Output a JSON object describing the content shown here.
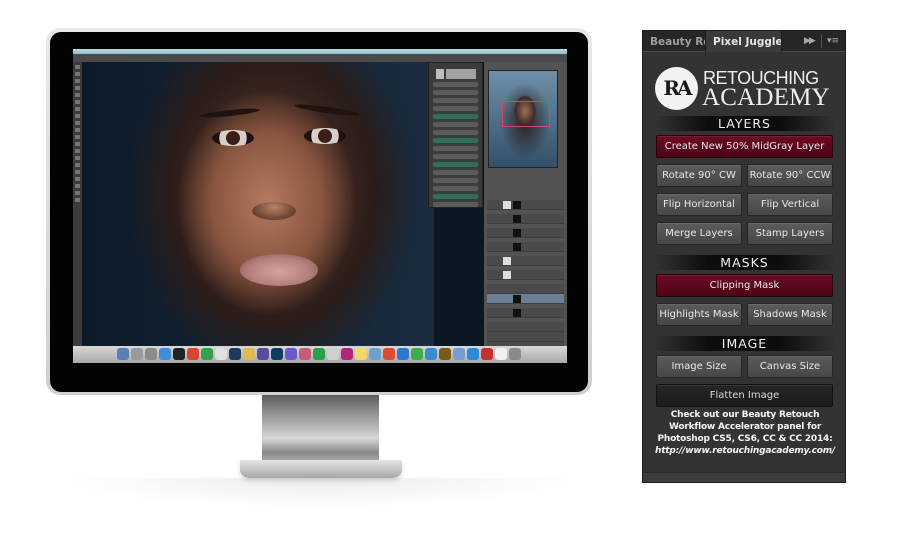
{
  "monitor": {
    "description": "Desktop monitor showing Photoshop with portrait retouching",
    "dock_icon_colors": [
      "#5a7fb5",
      "#9a9a9a",
      "#8c8c8c",
      "#3d8fd6",
      "#222222",
      "#d9452f",
      "#37a04a",
      "#e0e0e0",
      "#1c3a5e",
      "#e2b850",
      "#5a4aa0",
      "#0f3d5e",
      "#6a5acd",
      "#c85a7a",
      "#2aa04a",
      "#d0d0d0",
      "#b5237a",
      "#f0d86a",
      "#6fa0d0",
      "#e04a30",
      "#2a7ad0",
      "#3ab04a",
      "#3a8ad0",
      "#7a5a1a",
      "#7a9ad0",
      "#2a8ad8",
      "#c83030",
      "#f0f0f0",
      "#8a8a8a"
    ]
  },
  "panel": {
    "tabs": [
      {
        "label": "Beauty Ret",
        "active": false
      },
      {
        "label": "Pixel Juggler",
        "active": true
      }
    ],
    "collapse_icon": "double-chevron-right",
    "menu_icon": "panel-menu",
    "logo": {
      "monogram": "RA",
      "line1": "RETOUCHING",
      "line2": "ACADEMY"
    },
    "sections": {
      "layers": {
        "title": "LAYERS",
        "primary": "Create New 50% MidGray Layer",
        "rotate_cw": "Rotate 90° CW",
        "rotate_ccw": "Rotate 90° CCW",
        "flip_h": "Flip Horizontal",
        "flip_v": "Flip Vertical",
        "merge": "Merge Layers",
        "stamp": "Stamp Layers"
      },
      "masks": {
        "title": "MASKS",
        "primary": "Clipping Mask",
        "highlights": "Highlights Mask",
        "shadows": "Shadows Mask"
      },
      "image": {
        "title": "IMAGE",
        "image_size": "Image Size",
        "canvas_size": "Canvas Size",
        "flatten": "Flatten Image"
      }
    },
    "promo": {
      "text": "Check out our Beauty Retouch Workflow Accelerator panel for Photoshop CS5, CS6, CC & CC 2014:",
      "link": "http://www.retouchingacademy.com/"
    },
    "colors": {
      "panel_bg": "#333333",
      "accent_red": "#5e0820",
      "button_gray": "#505050"
    }
  }
}
